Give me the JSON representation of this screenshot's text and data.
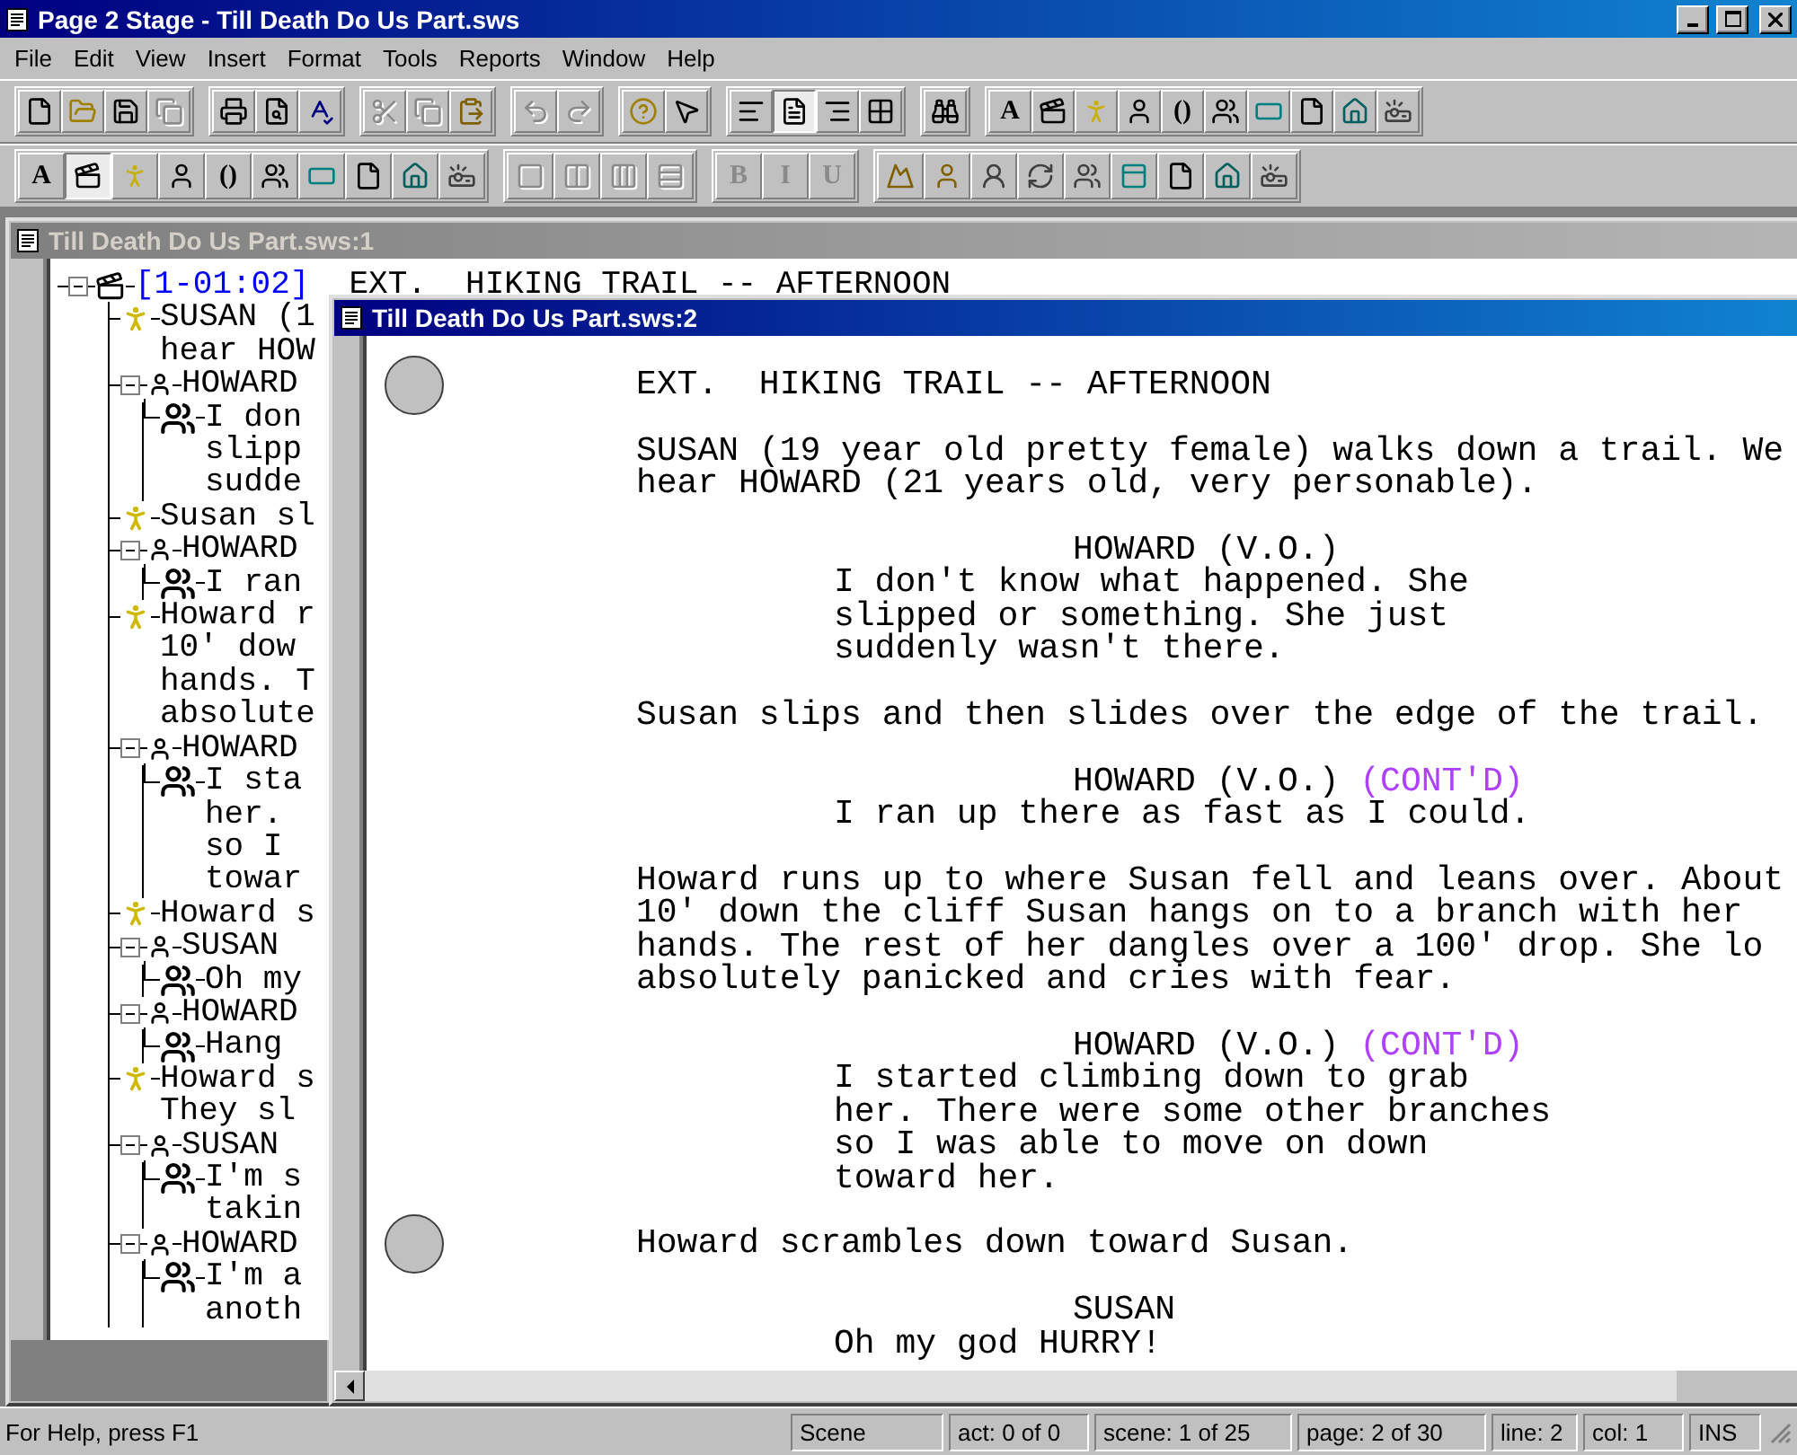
{
  "window": {
    "title": "Page 2 Stage - Till Death Do Us Part.sws"
  },
  "menu": [
    "File",
    "Edit",
    "View",
    "Insert",
    "Format",
    "Tools",
    "Reports",
    "Window",
    "Help"
  ],
  "toolbars": [
    [
      [
        {
          "kind": "new",
          "disabled": false,
          "selected": false
        },
        {
          "kind": "open",
          "disabled": false,
          "selected": false
        },
        {
          "kind": "save",
          "disabled": false,
          "selected": false
        },
        {
          "kind": "save-all",
          "disabled": true,
          "selected": false
        }
      ],
      [
        {
          "kind": "print",
          "disabled": false,
          "selected": false
        },
        {
          "kind": "print-preview",
          "disabled": false,
          "selected": false
        },
        {
          "kind": "spelling",
          "disabled": false,
          "selected": false
        }
      ],
      [
        {
          "kind": "cut",
          "disabled": true,
          "selected": false
        },
        {
          "kind": "copy",
          "disabled": true,
          "selected": false
        },
        {
          "kind": "paste",
          "disabled": false,
          "selected": false
        }
      ],
      [
        {
          "kind": "undo",
          "disabled": true,
          "selected": false
        },
        {
          "kind": "redo",
          "disabled": true,
          "selected": false
        }
      ],
      [
        {
          "kind": "help",
          "disabled": false,
          "selected": false
        },
        {
          "kind": "context-help",
          "disabled": false,
          "selected": false
        }
      ],
      [
        {
          "kind": "outline-view",
          "disabled": false,
          "selected": false
        },
        {
          "kind": "page-view",
          "disabled": false,
          "selected": true
        },
        {
          "kind": "script-view",
          "disabled": false,
          "selected": false
        },
        {
          "kind": "grid-view",
          "disabled": false,
          "selected": false
        }
      ],
      [
        {
          "kind": "find",
          "disabled": false,
          "selected": false
        }
      ],
      [
        {
          "kind": "text",
          "label": "A",
          "disabled": false,
          "selected": false
        },
        {
          "kind": "scene",
          "disabled": false,
          "selected": false
        },
        {
          "kind": "action",
          "disabled": false,
          "selected": false
        },
        {
          "kind": "character",
          "disabled": false,
          "selected": false
        },
        {
          "kind": "text",
          "label": "()",
          "disabled": false,
          "selected": false
        },
        {
          "kind": "dialogue",
          "disabled": false,
          "selected": false
        },
        {
          "kind": "screen",
          "disabled": false,
          "selected": false
        },
        {
          "kind": "page",
          "disabled": false,
          "selected": false
        },
        {
          "kind": "shot",
          "disabled": false,
          "selected": false
        },
        {
          "kind": "projector",
          "disabled": false,
          "selected": false
        }
      ]
    ],
    [
      [
        {
          "kind": "text",
          "label": "A",
          "disabled": false,
          "selected": false
        },
        {
          "kind": "scene",
          "disabled": false,
          "selected": true
        },
        {
          "kind": "action",
          "disabled": false,
          "selected": false
        },
        {
          "kind": "character",
          "disabled": false,
          "selected": false
        },
        {
          "kind": "text",
          "label": "()",
          "disabled": false,
          "selected": false
        },
        {
          "kind": "dialogue",
          "disabled": false,
          "selected": false
        },
        {
          "kind": "screen",
          "disabled": false,
          "selected": false
        },
        {
          "kind": "page",
          "disabled": false,
          "selected": false
        },
        {
          "kind": "shot",
          "disabled": false,
          "selected": false
        },
        {
          "kind": "projector",
          "disabled": false,
          "selected": false
        }
      ],
      [
        {
          "kind": "layout-1",
          "disabled": true,
          "selected": false
        },
        {
          "kind": "layout-2",
          "disabled": true,
          "selected": false
        },
        {
          "kind": "layout-3",
          "disabled": true,
          "selected": false
        },
        {
          "kind": "layout-4",
          "disabled": true,
          "selected": false
        }
      ],
      [
        {
          "kind": "text",
          "label": "B",
          "disabled": true,
          "selected": false
        },
        {
          "kind": "text",
          "label": "I",
          "disabled": true,
          "selected": false
        },
        {
          "kind": "text",
          "label": "U",
          "disabled": true,
          "selected": false
        }
      ],
      [
        {
          "kind": "mountain",
          "disabled": false,
          "selected": false
        },
        {
          "kind": "person",
          "disabled": false,
          "selected": false
        },
        {
          "kind": "person-round",
          "disabled": false,
          "selected": false
        },
        {
          "kind": "refresh",
          "disabled": false,
          "selected": false
        },
        {
          "kind": "people",
          "disabled": false,
          "selected": false
        },
        {
          "kind": "panel",
          "disabled": false,
          "selected": false
        },
        {
          "kind": "page",
          "disabled": false,
          "selected": false
        },
        {
          "kind": "shot",
          "disabled": false,
          "selected": false
        },
        {
          "kind": "projector",
          "disabled": false,
          "selected": false
        }
      ]
    ]
  ],
  "documents": [
    {
      "title": "Till Death Do Us Part.sws:1",
      "active": false,
      "kind": "outline",
      "tree": [
        {
          "kind": "scene",
          "number": "[1-01:02]",
          "lines": [
            "EXT.  HIKING TRAIL -- AFTERNOON"
          ],
          "expanded": true,
          "children": [
            {
              "kind": "action",
              "lines": [
                "SUSAN (1",
                "hear HOW"
              ]
            },
            {
              "kind": "character",
              "lines": [
                "HOWARD"
              ],
              "expanded": true,
              "children": [
                {
                  "kind": "dialogue",
                  "lines": [
                    "I don",
                    "slipp",
                    "sudde"
                  ]
                }
              ]
            },
            {
              "kind": "action",
              "lines": [
                "Susan sl"
              ]
            },
            {
              "kind": "character",
              "lines": [
                "HOWARD"
              ],
              "expanded": true,
              "children": [
                {
                  "kind": "dialogue",
                  "lines": [
                    "I ran"
                  ]
                }
              ]
            },
            {
              "kind": "action",
              "lines": [
                "Howard r",
                "10' dow",
                "hands. T",
                "absolute"
              ]
            },
            {
              "kind": "character",
              "lines": [
                "HOWARD"
              ],
              "expanded": true,
              "children": [
                {
                  "kind": "dialogue",
                  "lines": [
                    "I sta",
                    "her.",
                    "so I",
                    "towar"
                  ]
                }
              ]
            },
            {
              "kind": "action",
              "lines": [
                "Howard s"
              ]
            },
            {
              "kind": "character",
              "lines": [
                "SUSAN"
              ],
              "expanded": true,
              "children": [
                {
                  "kind": "dialogue",
                  "lines": [
                    "Oh my"
                  ]
                }
              ]
            },
            {
              "kind": "character",
              "lines": [
                "HOWARD"
              ],
              "expanded": true,
              "children": [
                {
                  "kind": "dialogue",
                  "lines": [
                    "Hang"
                  ]
                }
              ]
            },
            {
              "kind": "action",
              "lines": [
                "Howard s",
                "They sl"
              ]
            },
            {
              "kind": "character",
              "lines": [
                "SUSAN"
              ],
              "expanded": true,
              "children": [
                {
                  "kind": "dialogue",
                  "lines": [
                    "I'm s",
                    "takin"
                  ]
                }
              ]
            },
            {
              "kind": "character",
              "lines": [
                "HOWARD"
              ],
              "expanded": true,
              "children": [
                {
                  "kind": "dialogue",
                  "lines": [
                    "I'm a",
                    "anoth"
                  ]
                }
              ]
            }
          ]
        }
      ]
    },
    {
      "title": "Till Death Do Us Part.sws:2",
      "active": true,
      "kind": "script",
      "blocks": [
        {
          "kind": "heading",
          "marker": true,
          "lines": [
            "EXT.  HIKING TRAIL -- AFTERNOON"
          ]
        },
        {
          "kind": "action",
          "marker": false,
          "lines": [
            "SUSAN (19 year old pretty female) walks down a trail. We",
            "hear HOWARD (21 years old, very personable)."
          ]
        },
        {
          "kind": "character",
          "marker": false,
          "lines": [
            "HOWARD (V.O.)"
          ]
        },
        {
          "kind": "dialogue",
          "marker": false,
          "lines": [
            "I don't know what happened. She",
            "slipped or something. She just",
            "suddenly wasn't there."
          ]
        },
        {
          "kind": "action",
          "marker": false,
          "lines": [
            "Susan slips and then slides over the edge of the trail."
          ]
        },
        {
          "kind": "character",
          "marker": false,
          "lines": [
            "HOWARD (V.O.)"
          ],
          "extension": "(CONT'D)"
        },
        {
          "kind": "dialogue",
          "marker": false,
          "lines": [
            "I ran up there as fast as I could."
          ]
        },
        {
          "kind": "action",
          "marker": false,
          "lines": [
            "Howard runs up to where Susan fell and leans over. About",
            "10' down the cliff Susan hangs on to a branch with her",
            "hands. The rest of her dangles over a 100' drop. She lo",
            "absolutely panicked and cries with fear."
          ]
        },
        {
          "kind": "character",
          "marker": false,
          "lines": [
            "HOWARD (V.O.)"
          ],
          "extension": "(CONT'D)"
        },
        {
          "kind": "dialogue",
          "marker": false,
          "lines": [
            "I started climbing down to grab",
            "her. There were some other branches",
            "so I was able to move on down",
            "toward her."
          ]
        },
        {
          "kind": "action",
          "marker": true,
          "lines": [
            "Howard scrambles down toward Susan."
          ]
        },
        {
          "kind": "character",
          "marker": false,
          "lines": [
            "SUSAN"
          ]
        },
        {
          "kind": "dialogue",
          "marker": false,
          "lines": [
            "Oh my god HURRY!"
          ]
        }
      ]
    }
  ],
  "status_bar": {
    "help": "For Help, press F1",
    "panes": [
      "Scene",
      "act: 0 of 0",
      "scene: 1 of 25",
      "page: 2 of 30",
      "line: 2",
      "col: 1",
      "INS"
    ]
  }
}
